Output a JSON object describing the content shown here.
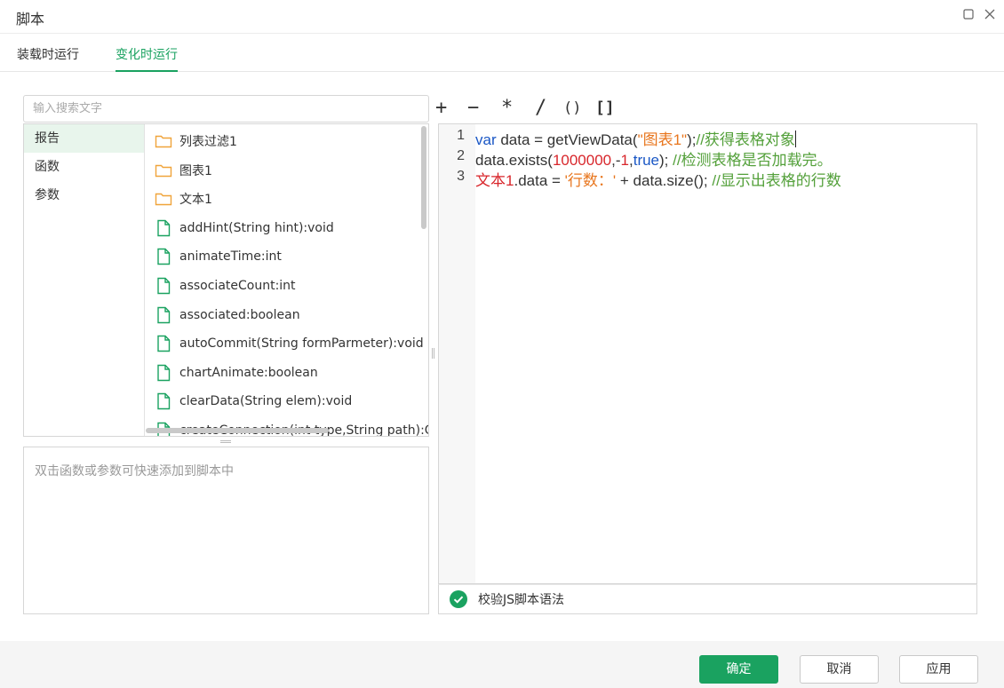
{
  "window": {
    "title": "脚本"
  },
  "tabs": [
    {
      "label": "装载时运行"
    },
    {
      "label": "变化时运行"
    }
  ],
  "search": {
    "placeholder": "输入搜索文字"
  },
  "categories": [
    {
      "label": "报告"
    },
    {
      "label": "函数"
    },
    {
      "label": "参数"
    }
  ],
  "items": [
    {
      "label": "列表过滤1",
      "icon": "folder-icon"
    },
    {
      "label": "图表1",
      "icon": "folder-icon"
    },
    {
      "label": "文本1",
      "icon": "folder-icon"
    },
    {
      "label": "addHint(String hint):void",
      "icon": "file-icon"
    },
    {
      "label": "animateTime:int",
      "icon": "file-icon"
    },
    {
      "label": "associateCount:int",
      "icon": "file-icon"
    },
    {
      "label": "associated:boolean",
      "icon": "file-icon"
    },
    {
      "label": "autoCommit(String formParmeter):void",
      "icon": "file-icon"
    },
    {
      "label": "chartAnimate:boolean",
      "icon": "file-icon"
    },
    {
      "label": "clearData(String elem):void",
      "icon": "file-icon"
    },
    {
      "label": "createConnection(int type,String path):Obje",
      "icon": "file-icon"
    }
  ],
  "hint": {
    "text": "双击函数或参数可快速添加到脚本中"
  },
  "operators": [
    "+",
    "−",
    "*",
    "/",
    "()",
    "[]"
  ],
  "editor": {
    "line_numbers": [
      "1",
      "2",
      "3"
    ],
    "lines": [
      [
        {
          "t": "var",
          "c": "kw"
        },
        {
          "t": " data = getViewData(",
          "c": "tx"
        },
        {
          "t": "\"图表1\"",
          "c": "str"
        },
        {
          "t": ");",
          "c": "tx"
        },
        {
          "t": "//获得表格对象",
          "c": "cm"
        }
      ],
      [
        {
          "t": "data.exists(",
          "c": "tx"
        },
        {
          "t": "1000000",
          "c": "num"
        },
        {
          "t": ",-",
          "c": "tx"
        },
        {
          "t": "1",
          "c": "num"
        },
        {
          "t": ",",
          "c": "tx"
        },
        {
          "t": "true",
          "c": "kw"
        },
        {
          "t": "); ",
          "c": "tx"
        },
        {
          "t": "//检测表格是否加载完。",
          "c": "cm"
        }
      ],
      [
        {
          "t": "文本1",
          "c": "var"
        },
        {
          "t": ".data = ",
          "c": "tx"
        },
        {
          "t": "'行数：'",
          "c": "str"
        },
        {
          "t": " + data.size(); ",
          "c": "tx"
        },
        {
          "t": "//显示出表格的行数",
          "c": "cm"
        }
      ]
    ]
  },
  "validate": {
    "label": "校验JS脚本语法"
  },
  "buttons": {
    "ok": "确定",
    "cancel": "取消",
    "apply": "应用"
  },
  "colors": {
    "accent": "#1aa260",
    "folder": "#f0a43a",
    "file": "#1aa260"
  }
}
